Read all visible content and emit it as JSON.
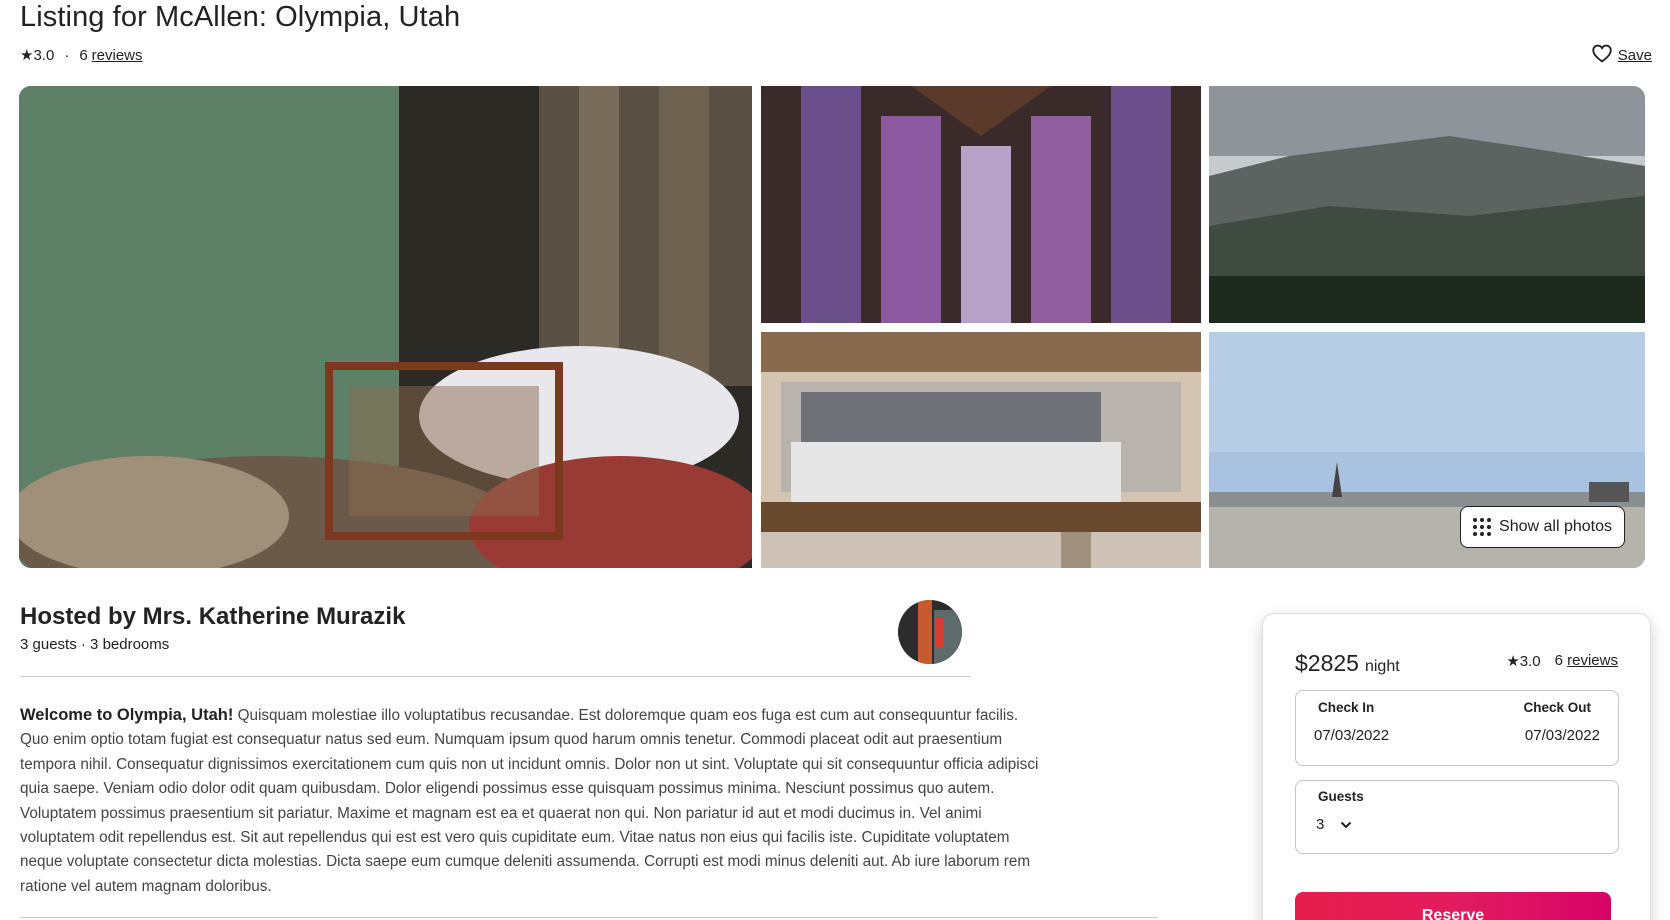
{
  "listing": {
    "title": "Listing for McAllen: Olympia, Utah",
    "rating": "★3.0",
    "separator": "·",
    "reviews_count": "6",
    "reviews_label": "reviews",
    "save_label": "Save"
  },
  "gallery": {
    "show_all_label": "Show all photos"
  },
  "host": {
    "title": "Hosted by Mrs. Katherine Murazik",
    "guests": "3 guests",
    "bedrooms": "· 3 bedrooms"
  },
  "description": {
    "heading": "Welcome to Olympia, Utah!",
    "body": "Quisquam molestiae illo voluptatibus recusandae. Est doloremque quam eos fuga est cum aut consequuntur facilis. Quo enim optio totam fugiat est consequatur natus sed eum. Numquam ipsum quod harum omnis tenetur. Commodi placeat odit aut praesentium tempora nihil. Consequatur dignissimos exercitationem cum quis non ut incidunt omnis. Dolor non ut sint. Voluptate qui sit consequuntur officia adipisci quia saepe. Veniam odio dolor odit quam quibusdam. Dolor eligendi possimus esse quisquam possimus minima. Nesciunt possimus quo autem. Voluptatem possimus praesentium sit pariatur. Maxime et magnam est ea et quaerat non qui. Non pariatur id aut et modi ducimus in. Vel animi voluptatem odit repellendus est. Sit aut repellendus qui est est vero quis cupiditate eum. Vitae natus non eius qui facilis iste. Cupiditate voluptatem neque voluptate consectetur dicta molestias. Dicta saepe eum cumque deleniti assumenda. Corrupti est modi minus deleniti aut. Ab iure laborum rem ratione vel autem magnam doloribus."
  },
  "booking": {
    "price": "$2825",
    "per": "night",
    "rating": "★3.0",
    "reviews_count": "6",
    "reviews_label": "reviews",
    "check_in_label": "Check In",
    "check_in_value": "07/03/2022",
    "check_out_label": "Check Out",
    "check_out_value": "07/03/2022",
    "guests_label": "Guests",
    "guests_value": "3",
    "reserve_label": "Reserve"
  },
  "icons": {
    "rating": "star-icon",
    "save": "heart-outline-icon",
    "show_all": "grid-dots-icon",
    "guests_select": "chevron-down-icon"
  }
}
